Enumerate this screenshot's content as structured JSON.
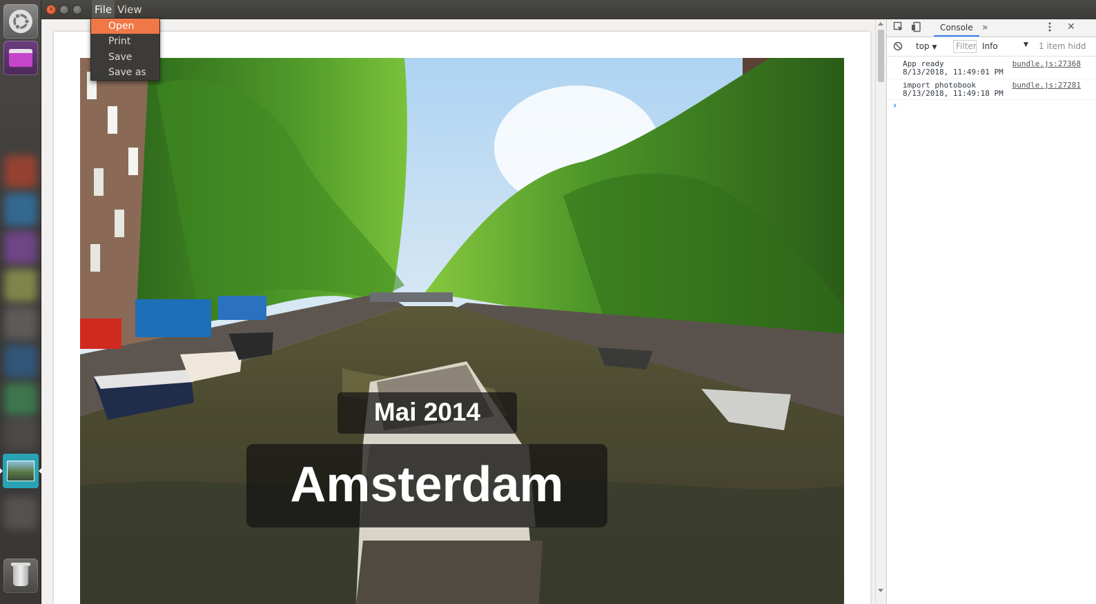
{
  "window": {
    "menubar": [
      {
        "label": "File"
      },
      {
        "label": "View"
      }
    ]
  },
  "file_menu": {
    "items": [
      {
        "label": "Open",
        "highlighted": true
      },
      {
        "label": "Print",
        "highlighted": false
      },
      {
        "label": "Save",
        "highlighted": false
      },
      {
        "label": "Save as",
        "highlighted": false
      }
    ],
    "highlight_color": "#f07746"
  },
  "photobook": {
    "date_label": "Mai 2014",
    "title": "Amsterdam"
  },
  "devtools": {
    "active_tab": "Console",
    "context": "top",
    "filter_placeholder": "Filter",
    "log_level": "Info",
    "hidden_count": "1 item hidd",
    "logs": [
      {
        "message": "App ready",
        "timestamp": "8/13/2018, 11:49:01 PM",
        "source": "bundle.js:27368"
      },
      {
        "message": "import photobook",
        "timestamp": "8/13/2018, 11:49:18 PM",
        "source": "bundle.js:27281"
      }
    ],
    "prompt_symbol": "›",
    "accent": "#3e82f7"
  },
  "launcher": {
    "items": [
      "ubuntu-dash",
      "app-window",
      "photobook-app",
      "trash"
    ]
  }
}
